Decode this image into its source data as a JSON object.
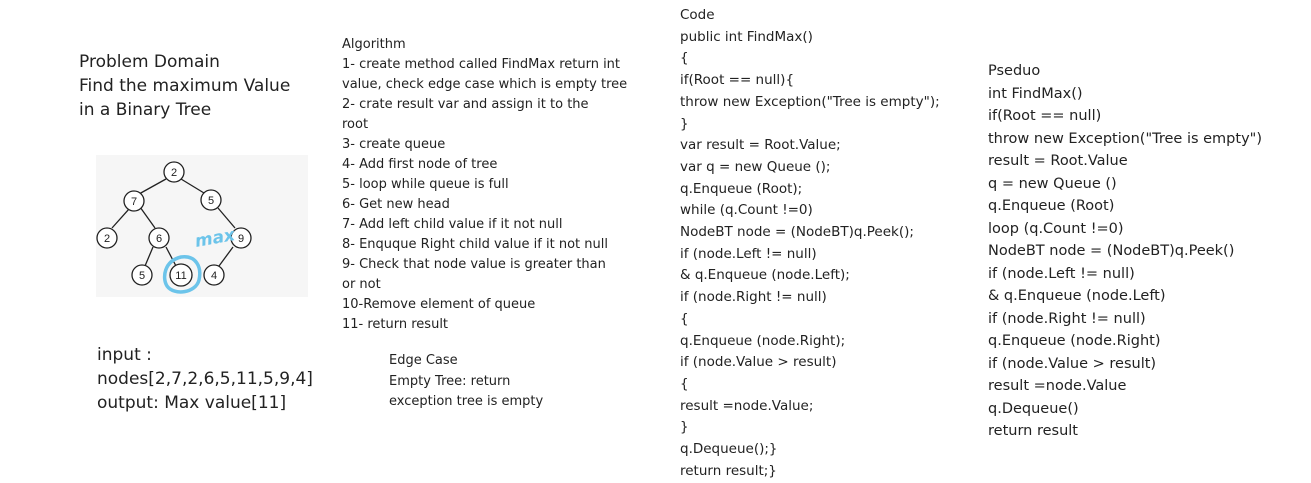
{
  "problem": {
    "lines": [
      "Problem Domain",
      "Find the maximum Value",
      "in a Binary Tree"
    ]
  },
  "tree": {
    "nodes": [
      "2",
      "7",
      "5",
      "2",
      "6",
      "9",
      "5",
      "11",
      "4"
    ],
    "annotation": "max",
    "colors": {
      "annotation": "#6cc4ea",
      "edge": "#222222",
      "background": "#f6f6f6"
    }
  },
  "io": {
    "lines": [
      "input :",
      "nodes[2,7,2,6,5,11,5,9,4]",
      "output: Max value[11]"
    ]
  },
  "algorithm": {
    "lines": [
      "Algorithm",
      "1- create method called FindMax return int",
      "value, check edge case which is empty tree",
      "2- crate result var and assign it to the",
      "root",
      "3- create queue",
      "4- Add first node of tree",
      "5- loop while queue is full",
      "6- Get new head",
      "7- Add left child value if it not null",
      "8- Enquque Right child value if it not null",
      "9- Check that node value is greater than",
      "or not",
      "10-Remove element of queue",
      "11- return result"
    ]
  },
  "edge_case": {
    "lines": [
      "Edge Case",
      "Empty Tree: return",
      "exception tree is empty"
    ]
  },
  "code": {
    "lines": [
      "Code",
      "public int FindMax()",
      "{",
      "if(Root == null){",
      "throw new Exception(\"Tree is empty\");",
      "}",
      "var result = Root.Value;",
      "var q = new Queue ();",
      "q.Enqueue (Root);",
      "while (q.Count !=0)",
      "NodeBT node = (NodeBT)q.Peek();",
      "if (node.Left != null)",
      "& q.Enqueue (node.Left);",
      "if (node.Right != null)",
      "{",
      "q.Enqueue (node.Right);",
      "if (node.Value > result)",
      "{",
      "result =node.Value;",
      "}",
      "q.Dequeue();}",
      "return result;}"
    ]
  },
  "pseudo": {
    "lines": [
      "Pseduo",
      "int FindMax()",
      "if(Root == null)",
      "throw new Exception(\"Tree is empty\")",
      "result = Root.Value",
      "q = new Queue ()",
      "q.Enqueue (Root)",
      "loop (q.Count !=0)",
      "NodeBT node = (NodeBT)q.Peek()",
      "if (node.Left != null)",
      "& q.Enqueue (node.Left)",
      "if (node.Right != null)",
      "q.Enqueue (node.Right)",
      "if (node.Value > result)",
      "result =node.Value",
      "q.Dequeue()",
      "return result"
    ]
  }
}
